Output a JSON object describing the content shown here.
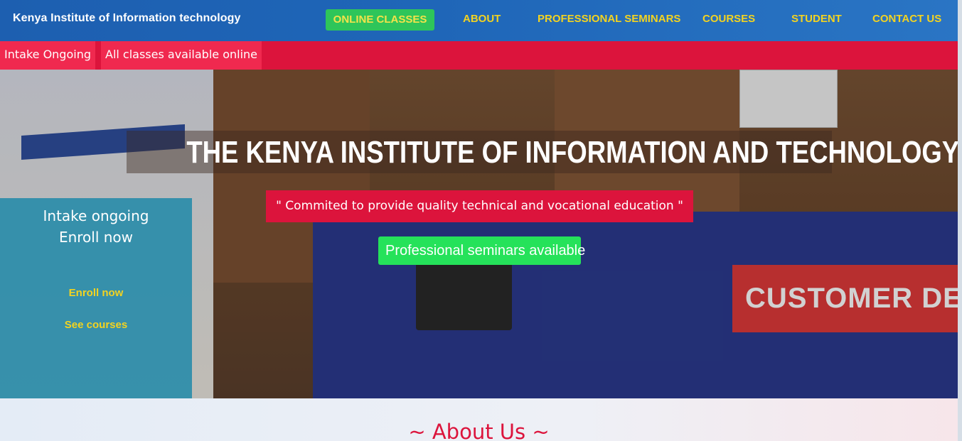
{
  "nav": {
    "brand": "Kenya Institute of Information technology",
    "online_classes": "ONLINE CLASSES",
    "about": "ABOUT",
    "seminars": "PROFESSIONAL SEMINARS",
    "courses": "COURSES",
    "student": "STUDENT",
    "contact": "CONTACT US"
  },
  "strip": {
    "chip1": "Intake Ongoing",
    "chip2": "All classes available online"
  },
  "hero": {
    "title": "THE KENYA INSTITUTE OF INFORMATION AND TECHNOLOGY",
    "tagline": "\" Commited to provide quality technical and vocational education \"",
    "seminar_button": "Professional seminars available",
    "sign_text": "CUSTOMER DE"
  },
  "enroll_panel": {
    "line1": "Intake ongoing",
    "line2": "Enroll now",
    "enroll_link": "Enroll now",
    "courses_link": "See courses"
  },
  "about": {
    "title": "~ About Us ~"
  },
  "colors": {
    "nav_blue": "#1f66b8",
    "nav_text": "#f3d320",
    "strip_red": "#dc143c",
    "online_green": "#2ec55a",
    "seminar_green": "#25e25a",
    "enroll_teal": "#288caa"
  }
}
